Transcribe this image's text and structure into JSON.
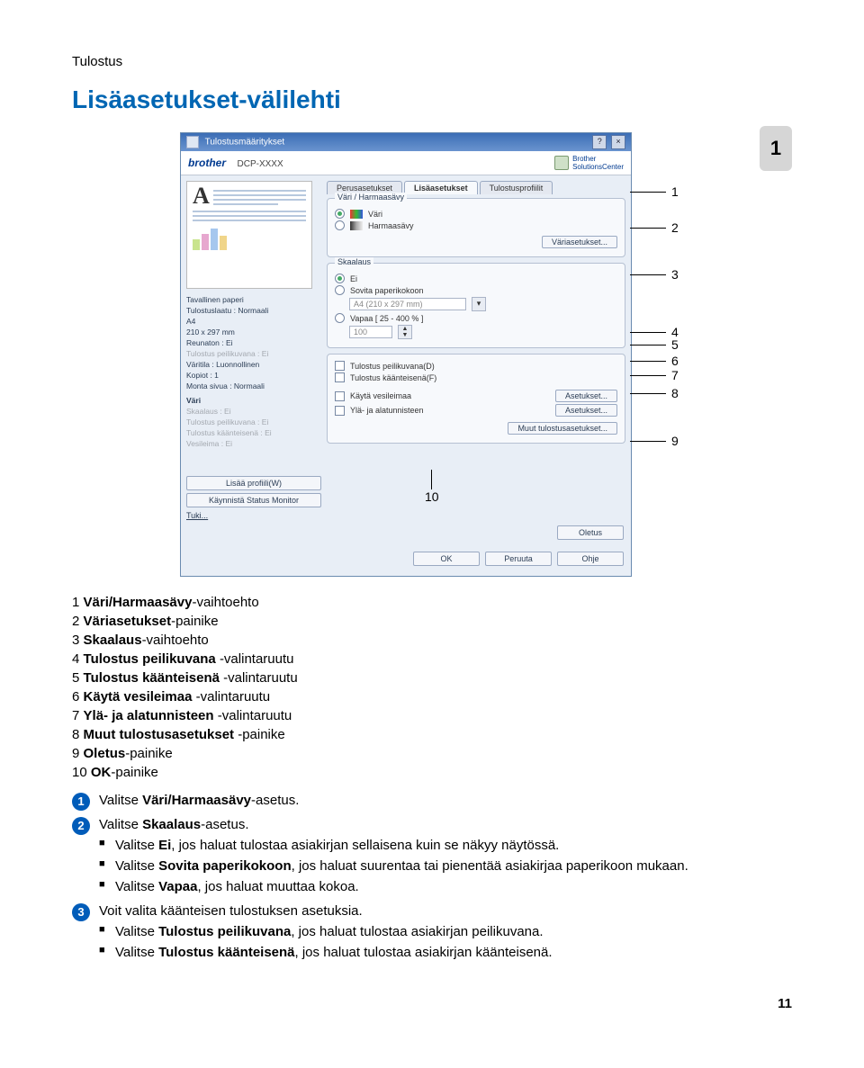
{
  "header": {
    "section": "Tulostus",
    "title": "Lisäasetukset-välilehti",
    "tab_badge": "1"
  },
  "callouts": {
    "c1": "1",
    "c2": "2",
    "c3": "3",
    "c4": "4",
    "c5": "5",
    "c6": "6",
    "c7": "7",
    "c8": "8",
    "c9": "9",
    "c10": "10"
  },
  "dialog": {
    "title": "Tulostusmääritykset",
    "help_icon": "?",
    "close_icon": "×",
    "brand": "brother",
    "model": "DCP-XXXX",
    "solutions": "Brother\nSolutionsCenter",
    "tabs": {
      "basic": "Perusasetukset",
      "adv": "Lisäasetukset",
      "profiles": "Tulostusprofiilit"
    },
    "specs": {
      "l1": "Tavallinen paperi",
      "l2": "Tulostuslaatu : Normaali",
      "l3": "A4",
      "l4": "210 x 297 mm",
      "l5": "Reunaton : Ei",
      "l6": "Tulostus peilikuvana : Ei",
      "l7": "Väritila : Luonnollinen",
      "l8": "Kopiot : 1",
      "l9": "Monta sivua : Normaali",
      "h1": "Väri",
      "g1": "Skaalaus : Ei",
      "g2": "Tulostus peilikuvana : Ei",
      "g3": "Tulostus käänteisenä : Ei",
      "g4": "Vesileima : Ei"
    },
    "colorgroup": {
      "label": "Väri / Harmaasävy",
      "opt_color": "Väri",
      "opt_gray": "Harmaasävy",
      "btn": "Väriasetukset..."
    },
    "scaling": {
      "label": "Skaalaus",
      "opt_no": "Ei",
      "opt_fit": "Sovita paperikokoon",
      "size": "A4 (210 x 297 mm)",
      "opt_free": "Vapaa [ 25 - 400 % ]",
      "value": "100"
    },
    "checks": {
      "mirror": "Tulostus peilikuvana(D)",
      "reverse": "Tulostus käänteisenä(F)",
      "wm": "Käytä vesileimaa",
      "wm_btn": "Asetukset...",
      "hf": "Ylä- ja alatunnisteen",
      "hf_btn": "Asetukset...",
      "other": "Muut tulostusasetukset..."
    },
    "left_buttons": {
      "add": "Lisää profiili(W)",
      "monitor": "Käynnistä Status Monitor",
      "support": "Tuki..."
    },
    "bottom": {
      "default": "Oletus",
      "ok": "OK",
      "cancel": "Peruuta",
      "help": "Ohje"
    }
  },
  "legend": {
    "i1_a": "1 ",
    "i1_b": "Väri/Harmaasävy",
    "i1_c": "-vaihtoehto",
    "i2_a": "2 ",
    "i2_b": "Väriasetukset",
    "i2_c": "-painike",
    "i3_a": "3 ",
    "i3_b": "Skaalaus",
    "i3_c": "-vaihtoehto",
    "i4_a": "4 ",
    "i4_b": "Tulostus peilikuvana ",
    "i4_c": "-valintaruutu",
    "i5_a": "5 ",
    "i5_b": "Tulostus käänteisenä ",
    "i5_c": "-valintaruutu",
    "i6_a": "6 ",
    "i6_b": "Käytä vesileimaa ",
    "i6_c": "-valintaruutu",
    "i7_a": "7 ",
    "i7_b": "Ylä- ja alatunnisteen ",
    "i7_c": "-valintaruutu",
    "i8_a": "8 ",
    "i8_b": "Muut tulostusasetukset ",
    "i8_c": "-painike",
    "i9_a": "9 ",
    "i9_b": "Oletus",
    "i9_c": "-painike",
    "i10_a": "10 ",
    "i10_b": "OK",
    "i10_c": "-painike"
  },
  "steps": {
    "s1_a": "Valitse ",
    "s1_b": "Väri/Harmaasävy",
    "s1_c": "-asetus.",
    "s2_a": "Valitse ",
    "s2_b": "Skaalaus",
    "s2_c": "-asetus.",
    "b1_a": "Valitse ",
    "b1_b": "Ei",
    "b1_c": ", jos haluat tulostaa asiakirjan sellaisena kuin se näkyy näytössä.",
    "b2_a": "Valitse ",
    "b2_b": "Sovita paperikokoon",
    "b2_c": ", jos haluat suurentaa tai pienentää asiakirjaa paperikoon mukaan.",
    "b3_a": "Valitse ",
    "b3_b": "Vapaa",
    "b3_c": ", jos haluat muuttaa kokoa.",
    "s3": "Voit valita käänteisen tulostuksen asetuksia.",
    "b4_a": "Valitse ",
    "b4_b": "Tulostus peilikuvana",
    "b4_c": ", jos haluat tulostaa asiakirjan peilikuvana.",
    "b5_a": "Valitse ",
    "b5_b": "Tulostus käänteisenä",
    "b5_c": ", jos haluat tulostaa asiakirjan käänteisenä."
  },
  "page_number": "11"
}
